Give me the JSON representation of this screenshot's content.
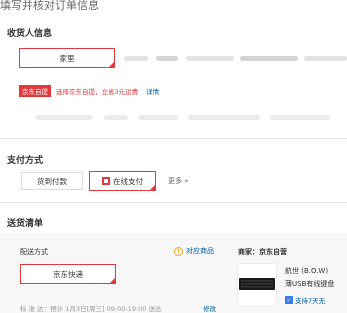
{
  "page": {
    "title": "填写并核对订单信息"
  },
  "consignee": {
    "section_title": "收货人信息",
    "selected_address": "家里",
    "pickup_badge": "京东自提",
    "pickup_promo": "选择京东自提，立省3元运费",
    "pickup_details": "详情"
  },
  "payment": {
    "section_title": "支付方式",
    "cod_label": "货到付款",
    "online_label": "在线支付",
    "more_label": "更多 »"
  },
  "delivery": {
    "section_title": "送货清单",
    "shipping_method_label": "配送方式",
    "corresponding_items": "对应商品",
    "shipping_option": "京东快递",
    "standard_label": "标 准 达：预计 1月3日[周三] 09:00-19:00 送达",
    "modify_label": "修改",
    "seller_label": "商家：京东自营",
    "product_title_line1": "航世 (B.O.W)",
    "product_title_line2": "薄USB有线键盘",
    "product_badge": "支持7天无"
  }
}
